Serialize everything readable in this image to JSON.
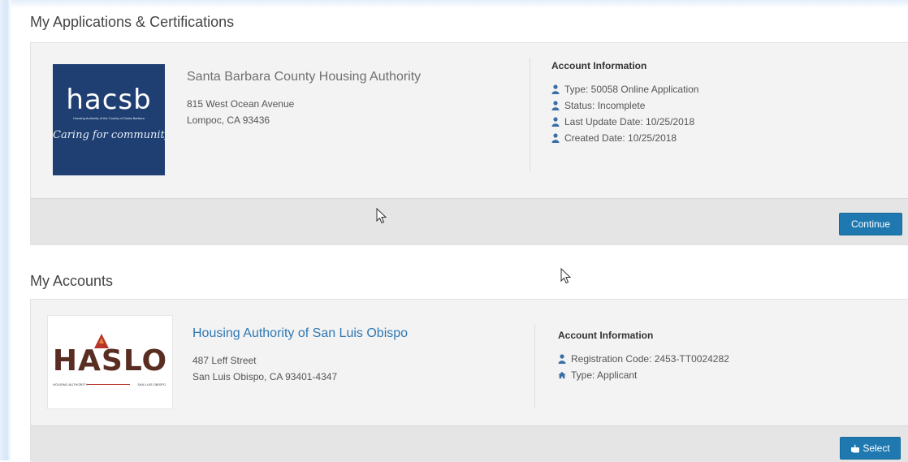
{
  "applications": {
    "section_title": "My Applications & Certifications",
    "org": {
      "logo": {
        "word": "hacsb",
        "subline": "Housing Authority of the County of Santa Barbara",
        "tagline": "Caring for community"
      },
      "name": "Santa Barbara County Housing Authority",
      "address_line1": "815 West Ocean Avenue",
      "address_line2": "Lompoc, CA 93436"
    },
    "account_info": {
      "heading": "Account Information",
      "items": [
        {
          "icon": "user-icon",
          "text": "Type: 50058 Online Application"
        },
        {
          "icon": "user-icon",
          "text": "Status: Incomplete"
        },
        {
          "icon": "user-icon",
          "text": "Last Update Date: 10/25/2018"
        },
        {
          "icon": "user-icon",
          "text": "Created Date: 10/25/2018"
        }
      ]
    },
    "continue_label": "Continue"
  },
  "accounts": {
    "section_title": "My Accounts",
    "org": {
      "logo": {
        "word": "HASLO",
        "left_caption": "HOUSING AUTHORITY",
        "right_caption": "SAN LUIS OBISPO"
      },
      "name": "Housing Authority of San Luis Obispo",
      "address_line1": "487 Leff Street",
      "address_line2": "San Luis Obispo, CA 93401-4347"
    },
    "account_info": {
      "heading": "Account Information",
      "items": [
        {
          "icon": "user-icon",
          "text": "Registration Code: 2453-TT0024282"
        },
        {
          "icon": "home-icon",
          "text": "Type: Applicant"
        }
      ]
    },
    "select_label": "Select",
    "select_icon": "hand-pointer-icon"
  },
  "colors": {
    "accent": "#1f79b0",
    "link": "#2f78b3",
    "hacsb_blue": "#1f3f72",
    "haslo_red": "#b8352a"
  }
}
